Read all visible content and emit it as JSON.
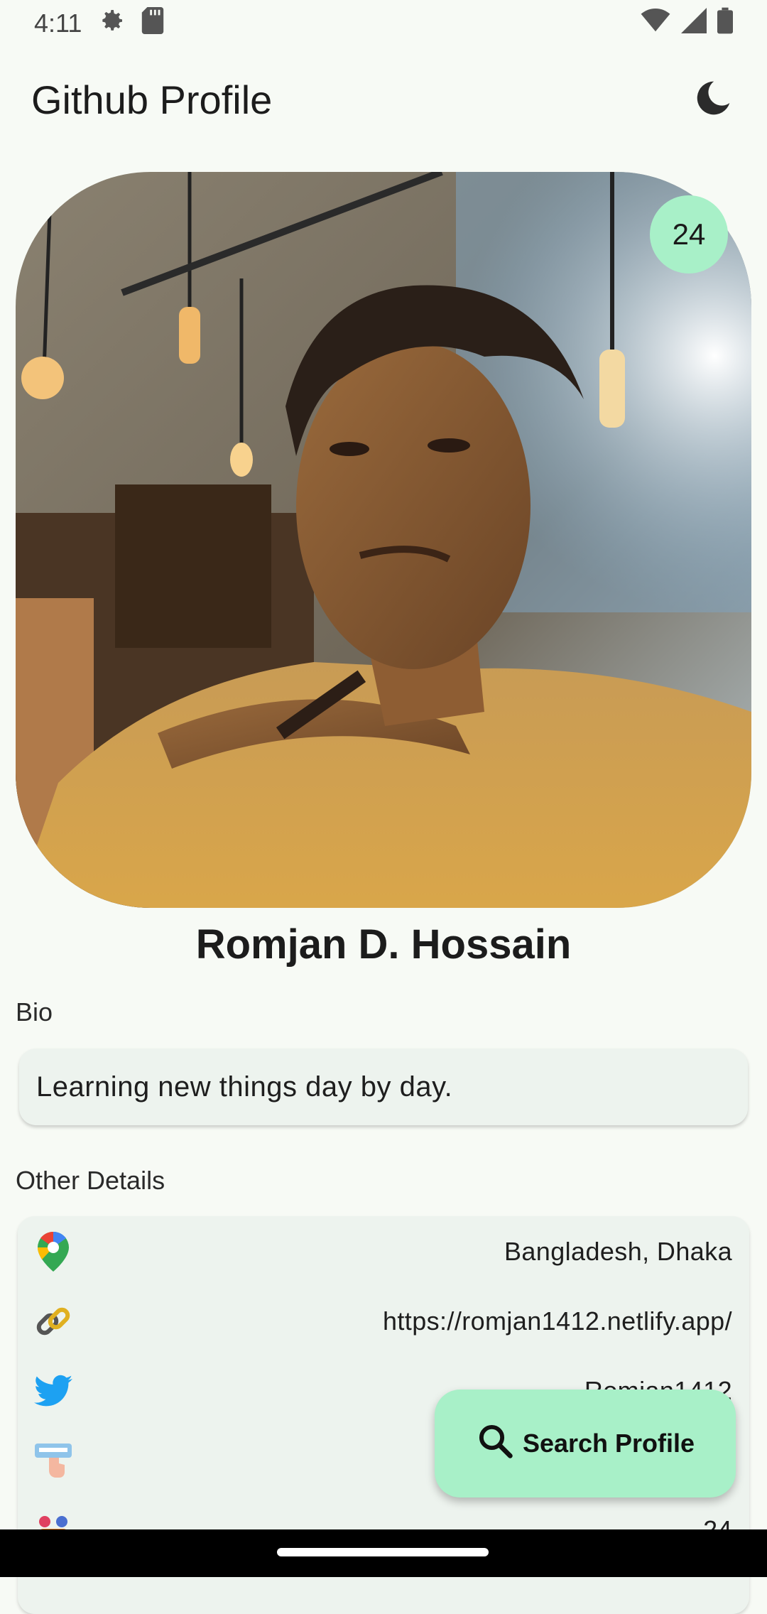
{
  "status_bar": {
    "time": "4:11",
    "icons": [
      "settings-icon",
      "sd-card-icon",
      "wifi-icon",
      "signal-icon",
      "battery-icon"
    ]
  },
  "app_bar": {
    "title": "Github Profile",
    "theme_icon": "moon-icon"
  },
  "profile": {
    "badge_count": "24",
    "name": "Romjan D. Hossain"
  },
  "bio": {
    "label": "Bio",
    "text": "Learning new things day by day."
  },
  "other_details": {
    "label": "Other Details",
    "rows": [
      {
        "icon": "map-pin-icon",
        "value": "Bangladesh, Dhaka"
      },
      {
        "icon": "link-icon",
        "value": "https://romjan1412.netlify.app/"
      },
      {
        "icon": "twitter-icon",
        "value": "Romjan1412"
      },
      {
        "icon": "follow-icon",
        "value": ""
      },
      {
        "icon": "group-icon",
        "value": "24"
      }
    ]
  },
  "fab": {
    "label": "Search Profile",
    "icon": "search-icon"
  },
  "colors": {
    "accent": "#a8f0c8",
    "background": "#f7faf5",
    "card": "#edf3ee"
  }
}
